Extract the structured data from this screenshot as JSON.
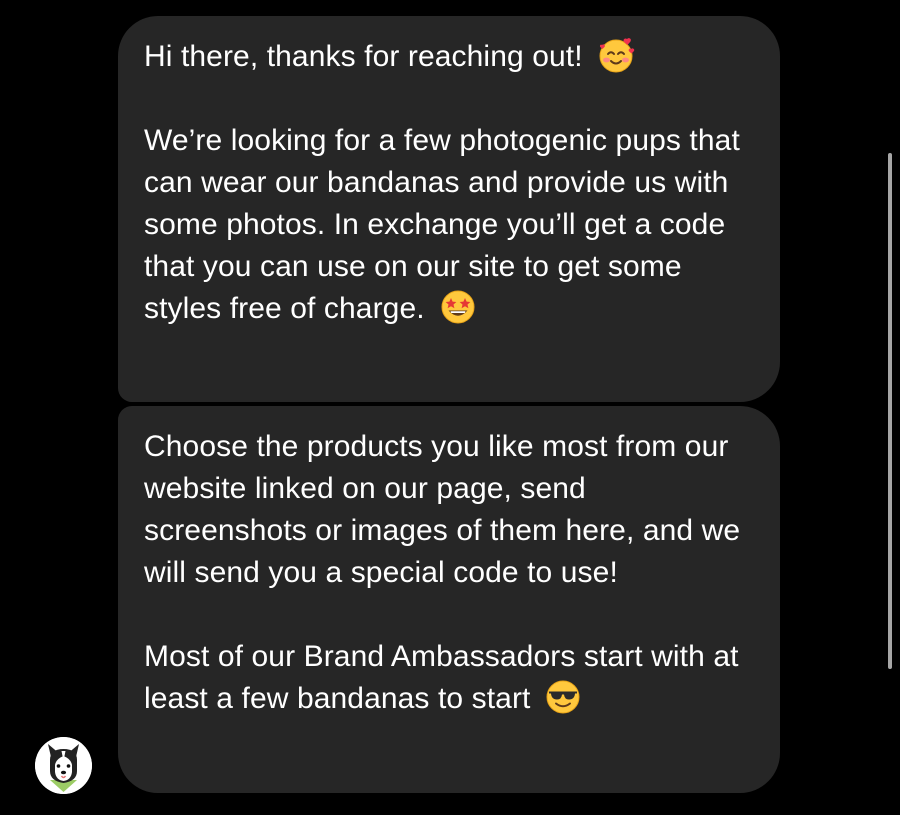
{
  "messages": [
    {
      "paragraphs": [
        {
          "text": "Hi there, thanks for reaching out!",
          "emoji": "smiling-face-with-hearts-icon"
        },
        {
          "text": "We’re looking for a few photogenic pups that can wear our bandanas and provide us with some photos. In exchange you’ll get a code that you can use on our site to get some styles free of charge.",
          "emoji": "star-struck-icon"
        }
      ]
    },
    {
      "paragraphs": [
        {
          "text": "Choose the products you like most from our website linked on our page, send screenshots or images of them here, and we will send you a special code to use!"
        },
        {
          "text": "Most of our Brand Ambassadors start with at least a few bandanas to start",
          "emoji": "sunglasses-face-icon"
        }
      ]
    }
  ],
  "sender": {
    "avatar_icon": "husky-dog-avatar-icon"
  },
  "colors": {
    "background": "#000000",
    "bubble": "#262626",
    "text": "#ffffff",
    "scrollbar": "#a6a6a6",
    "avatar_bandana": "#9ccc65"
  }
}
